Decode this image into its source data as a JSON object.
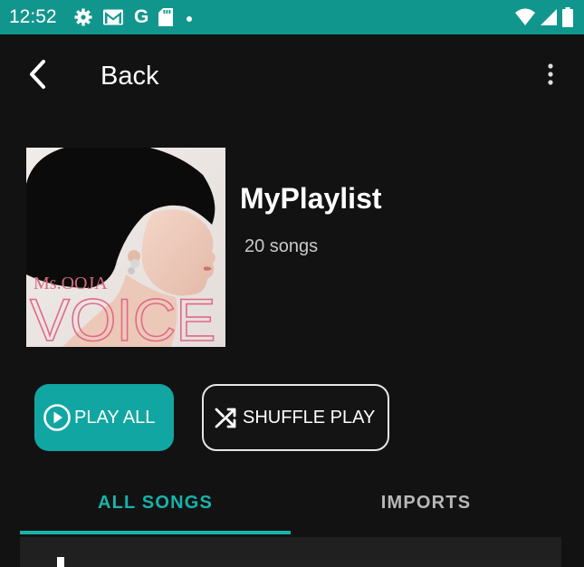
{
  "status_bar": {
    "time": "12:52",
    "background": "#11968E",
    "left_icons": [
      "settings-icon",
      "gmail-icon",
      "google-icon",
      "sd-card-icon",
      "dot-icon"
    ],
    "google_letter": "G",
    "right_icons": [
      "wifi-icon",
      "signal-icon",
      "battery-icon"
    ]
  },
  "toolbar": {
    "back_label": "Back",
    "back_icon": "chevron-left-icon",
    "menu_icon": "more-vert-icon"
  },
  "playlist": {
    "title": "MyPlaylist",
    "song_count": "20 songs",
    "album_art": {
      "artist_text": "Ms.OOJA",
      "album_text": "VOICE"
    }
  },
  "actions": {
    "play_all_label": "PLAY ALL",
    "shuffle_play_label": "SHUFFLE PLAY",
    "accent_color": "#12A6A2"
  },
  "tabs": [
    {
      "label": "ALL SONGS",
      "selected": true
    },
    {
      "label": "IMPORTS",
      "selected": false
    }
  ]
}
